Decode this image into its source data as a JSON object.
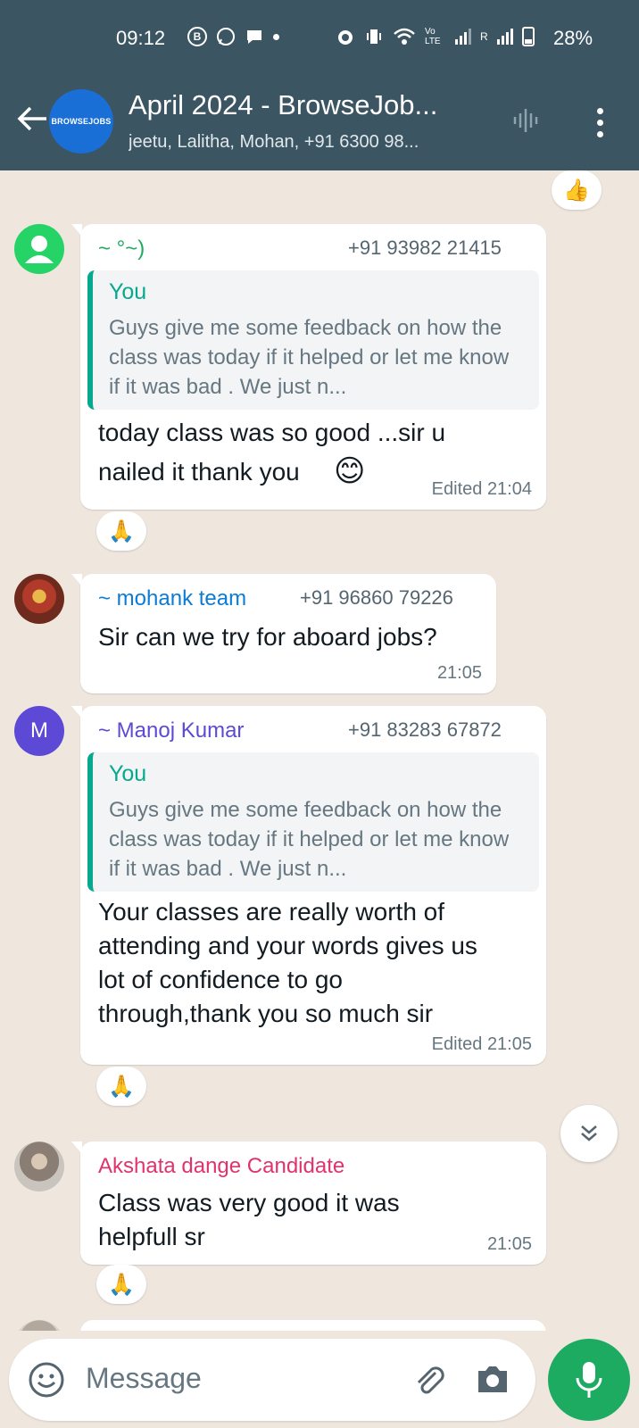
{
  "status_bar": {
    "time": "09:12",
    "battery": "28%",
    "lte": "Vo LTE",
    "roaming": "R"
  },
  "header": {
    "group_title": "April 2024 - BrowseJob...",
    "group_subtitle": "jeetu, Lalitha, Mohan, +91 6300 98...",
    "avatar_text": "BROWSEJOBS"
  },
  "top_reaction": "👍",
  "messages": [
    {
      "sender": "~ °~)",
      "phone": "+91 93982 21415",
      "quote": {
        "name": "You",
        "text": "Guys give me some feedback on how the class was today if it helped or let me know if it was bad . We just n..."
      },
      "body_line1": "today class was so good ...sir u",
      "body_line2": "nailed it thank you",
      "emoji": "😊",
      "meta": "Edited 21:04",
      "reaction": "🙏"
    },
    {
      "sender": "~ mohank team",
      "phone": "+91 96860 79226",
      "body": "Sir can we try for aboard jobs?",
      "meta": "21:05"
    },
    {
      "avatar_letter": "M",
      "sender": "~ Manoj Kumar",
      "phone": "+91 83283 67872",
      "quote": {
        "name": "You",
        "text": "Guys give me some feedback on how the class was today if it helped or let me know if it was bad . We just n..."
      },
      "body": "Your classes are really worth of attending and your words gives us lot of confidence to go through,thank you so much sir",
      "meta": "Edited 21:05",
      "reaction": "🙏"
    },
    {
      "sender": "Akshata dange Candidate",
      "body": "Class was very good it was helpfull sr",
      "meta": "21:05",
      "reaction": "🙏"
    }
  ],
  "compose": {
    "placeholder": "Message"
  },
  "colors": {
    "header_bg": "#3b5563",
    "chat_bg": "#efe7de",
    "sender1": "#1daa61",
    "sender2": "#0a7cd6",
    "sender3": "#5c4ad6",
    "sender4": "#e0336e",
    "quote_accent": "#06a88e",
    "mic_button": "#1daa61"
  }
}
